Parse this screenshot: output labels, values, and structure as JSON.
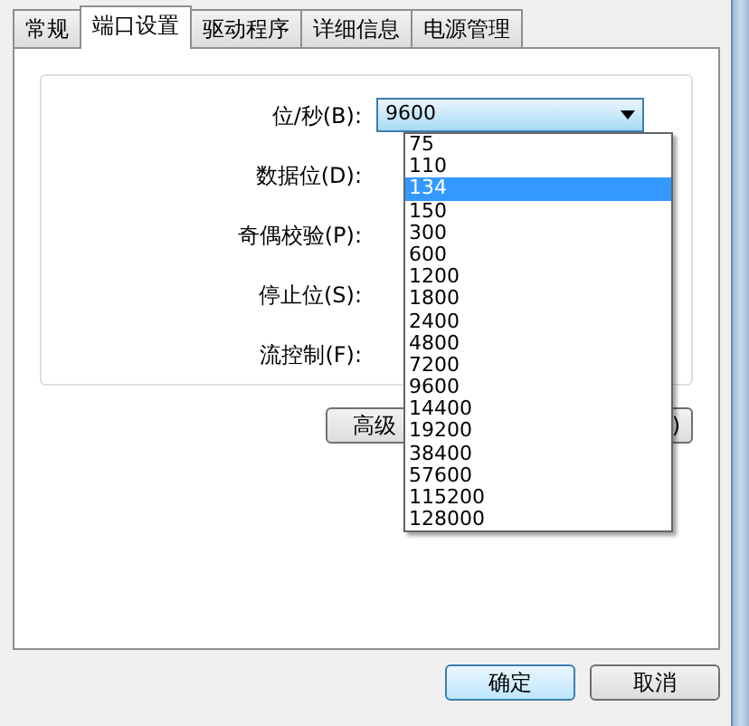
{
  "tabs": [
    {
      "label": "常规",
      "selected": false
    },
    {
      "label": "端口设置",
      "selected": true
    },
    {
      "label": "驱动程序",
      "selected": false
    },
    {
      "label": "详细信息",
      "selected": false
    },
    {
      "label": "电源管理",
      "selected": false
    }
  ],
  "fields": [
    {
      "label": "位/秒(B):",
      "value": "9600",
      "expanded": true
    },
    {
      "label": "数据位(D):"
    },
    {
      "label": "奇偶校验(P):"
    },
    {
      "label": "停止位(S):"
    },
    {
      "label": "流控制(F):"
    }
  ],
  "dropdown": [
    {
      "text": "75",
      "selected": false
    },
    {
      "text": "110",
      "selected": false
    },
    {
      "text": "134",
      "selected": true
    },
    {
      "text": "150",
      "selected": false
    },
    {
      "text": "300",
      "selected": false
    },
    {
      "text": "600",
      "selected": false
    },
    {
      "text": "1200",
      "selected": false
    },
    {
      "text": "1800",
      "selected": false
    },
    {
      "text": "2400",
      "selected": false
    },
    {
      "text": "4800",
      "selected": false
    },
    {
      "text": "7200",
      "selected": false
    },
    {
      "text": "9600",
      "selected": false
    },
    {
      "text": "14400",
      "selected": false
    },
    {
      "text": "19200",
      "selected": false
    },
    {
      "text": "38400",
      "selected": false
    },
    {
      "text": "57600",
      "selected": false
    },
    {
      "text": "115200",
      "selected": false
    },
    {
      "text": "128000",
      "selected": false
    }
  ],
  "panel_buttons": [
    "高级",
    ")"
  ],
  "dialog_buttons": [
    {
      "label": "确定",
      "default": true
    },
    {
      "label": "取消",
      "default": false
    }
  ]
}
